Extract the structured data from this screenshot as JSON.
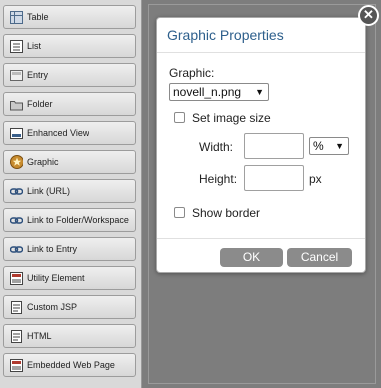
{
  "palette": {
    "items": [
      {
        "label": "Table",
        "icon": "table-icon"
      },
      {
        "label": "List",
        "icon": "list-icon"
      },
      {
        "label": "Entry",
        "icon": "entry-icon"
      },
      {
        "label": "Folder",
        "icon": "folder-icon"
      },
      {
        "label": "Enhanced View",
        "icon": "enhanced-view-icon"
      },
      {
        "label": "Graphic",
        "icon": "graphic-star-icon"
      },
      {
        "label": "Link (URL)",
        "icon": "link-icon"
      },
      {
        "label": "Link to Folder/Workspace",
        "icon": "link-folder-icon"
      },
      {
        "label": "Link to Entry",
        "icon": "link-entry-icon"
      },
      {
        "label": "Utility Element",
        "icon": "utility-icon"
      },
      {
        "label": "Custom JSP",
        "icon": "jsp-icon"
      },
      {
        "label": "HTML",
        "icon": "html-icon"
      },
      {
        "label": "Embedded Web Page",
        "icon": "web-page-icon"
      }
    ]
  },
  "dialog": {
    "title": "Graphic Properties",
    "graphic_label": "Graphic:",
    "graphic_value": "novell_n.png",
    "set_image_size_label": "Set image size",
    "width_label": "Width:",
    "width_value": "",
    "unit_value": "%",
    "height_label": "Height:",
    "height_value": "",
    "height_unit": "px",
    "show_border_label": "Show border",
    "ok_label": "OK",
    "cancel_label": "Cancel"
  },
  "close_glyph": "✕",
  "colors": {
    "title": "#2d5f8c",
    "button": "#8b8b8b",
    "backdrop": "#7d7d7d"
  }
}
